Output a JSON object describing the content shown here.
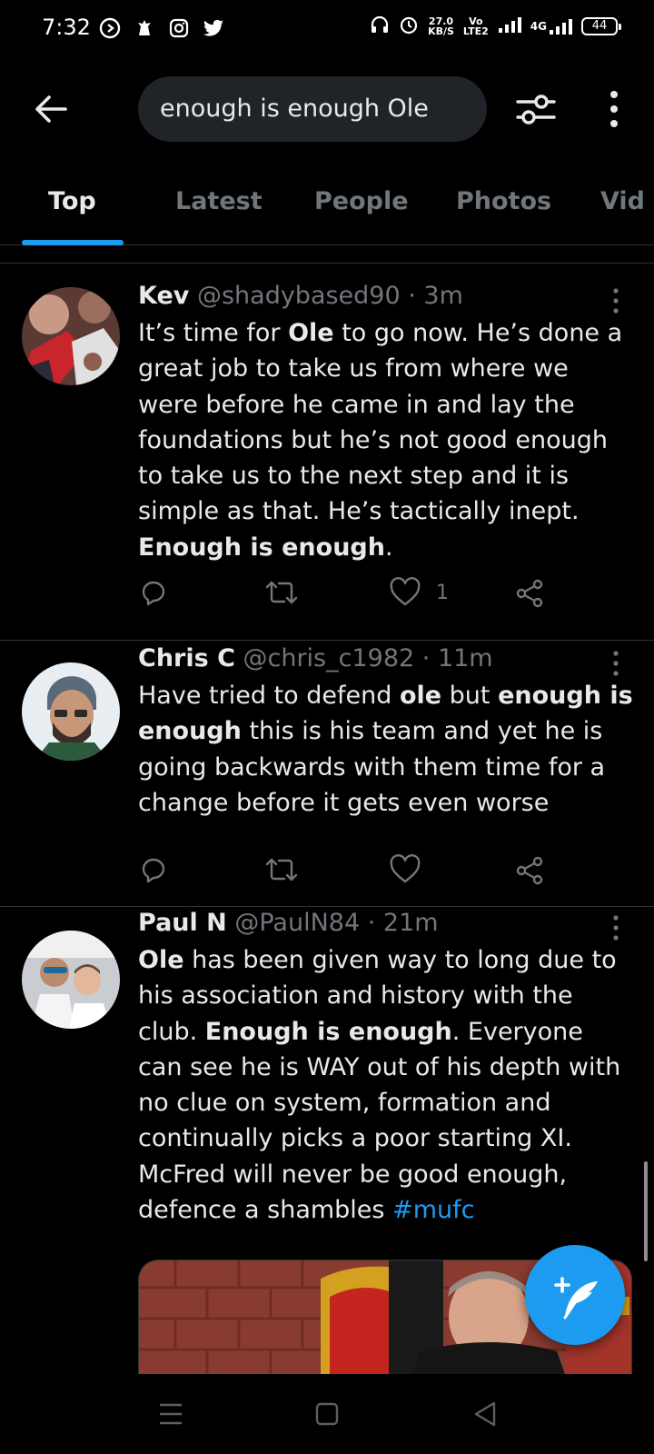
{
  "status_bar": {
    "time": "7:32",
    "net_speed_value": "27.0",
    "net_speed_unit": "KB/S",
    "volte_top": "Vo",
    "volte_bottom": "LTE2",
    "network": "4G",
    "battery": "44",
    "left_icons": [
      "media-play-icon",
      "premier-league-icon",
      "instagram-icon",
      "twitter-bird-icon"
    ],
    "right_icons": [
      "headphones-icon",
      "alarm-icon",
      "signal-icon"
    ]
  },
  "header": {
    "search_value": "enough is enough Ole",
    "icons": [
      "back-arrow-icon",
      "search-filter-icon",
      "more-vertical-icon"
    ]
  },
  "tabs": [
    "Top",
    "Latest",
    "People",
    "Photos",
    "Vid"
  ],
  "active_tab": 0,
  "tweets": [
    {
      "name": "Kev",
      "handle": "@shadybased90",
      "time": "3m",
      "segments": [
        {
          "t": "It’s time for "
        },
        {
          "t": "Ole",
          "b": true
        },
        {
          "t": " to go now. He’s done a great job to take us from where we were before he came in and lay the foundations but he’s not good enough to take us to the next step and it is simple as that. He’s tactically inept. "
        },
        {
          "t": "Enough is enough",
          "b": true
        },
        {
          "t": "."
        }
      ],
      "likes": "1"
    },
    {
      "name": "Chris C",
      "handle": "@chris_c1982",
      "time": "11m",
      "segments": [
        {
          "t": "Have tried to defend "
        },
        {
          "t": "ole",
          "b": true
        },
        {
          "t": " but "
        },
        {
          "t": "enough is enough",
          "b": true
        },
        {
          "t": " this is his team and yet he is going backwards with them time for a change before it gets even worse"
        }
      ],
      "likes": ""
    },
    {
      "name": "Paul N",
      "handle": "@PaulN84",
      "time": "21m",
      "segments": [
        {
          "t": "Ole",
          "b": true
        },
        {
          "t": " has been given way to long due to his association and history with the club. "
        },
        {
          "t": "Enough is enough",
          "b": true
        },
        {
          "t": ". Everyone can see he is WAY out of his depth with no clue on system, formation and continually picks a poor starting XI. McFred will never be good enough, defence a shambles "
        },
        {
          "t": "#mufc",
          "h": true
        }
      ],
      "likes": ""
    }
  ],
  "tweet_separator": " · ",
  "action_icons": [
    "reply-icon",
    "retweet-icon",
    "like-icon",
    "share-icon"
  ],
  "fab_icon": "compose-tweet-icon",
  "nav_icons": [
    "recents-icon",
    "home-icon",
    "back-icon"
  ],
  "colors": {
    "accent": "#1d9bf0",
    "background": "#000000",
    "muted": "#71767b",
    "text": "#e7e9ea"
  }
}
